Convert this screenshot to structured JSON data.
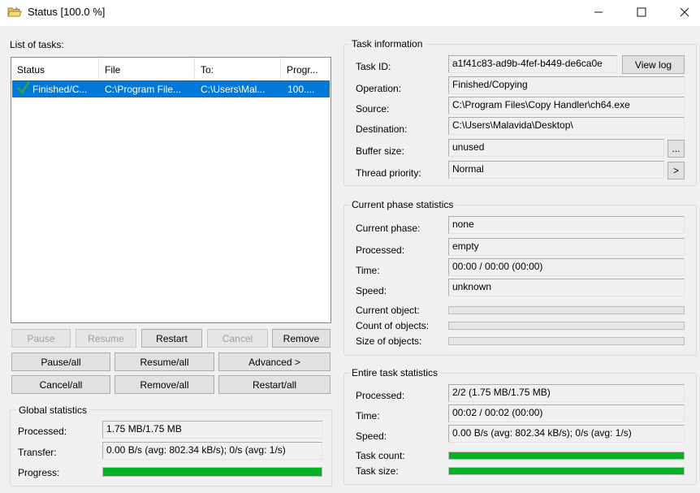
{
  "window": {
    "title": "Status [100.0 %]"
  },
  "tasks": {
    "heading": "List of tasks:",
    "columns": [
      "Status",
      "File",
      "To:",
      "Progr..."
    ],
    "rows": [
      {
        "status": "Finished/C...",
        "file": "C:\\Program File...",
        "to": "C:\\Users\\Mal...",
        "progress": "100...."
      }
    ]
  },
  "task_buttons": {
    "pause": "Pause",
    "resume": "Resume",
    "restart": "Restart",
    "cancel": "Cancel",
    "remove": "Remove",
    "pause_all": "Pause/all",
    "resume_all": "Resume/all",
    "advanced": "Advanced >",
    "cancel_all": "Cancel/all",
    "remove_all": "Remove/all",
    "restart_all": "Restart/all"
  },
  "global_stats": {
    "title": "Global statistics",
    "processed_label": "Processed:",
    "processed": "1.75 MB/1.75 MB",
    "transfer_label": "Transfer:",
    "transfer": "0.00 B/s (avg: 802.34 kB/s); 0/s (avg: 1/s)",
    "progress_label": "Progress:",
    "progress_value": 1.0
  },
  "task_info": {
    "title": "Task information",
    "task_id_label": "Task ID:",
    "task_id": "a1f41c83-ad9b-4fef-b449-de6ca0e",
    "view_log": "View log",
    "operation_label": "Operation:",
    "operation": "Finished/Copying",
    "source_label": "Source:",
    "source": "C:\\Program Files\\Copy Handler\\ch64.exe",
    "destination_label": "Destination:",
    "destination": "C:\\Users\\Malavida\\Desktop\\",
    "buffer_label": "Buffer size:",
    "buffer": "unused",
    "buffer_btn": "...",
    "thread_label": "Thread priority:",
    "thread": "Normal",
    "thread_btn": ">"
  },
  "phase_stats": {
    "title": "Current phase statistics",
    "phase_label": "Current phase:",
    "phase": "none",
    "processed_label": "Processed:",
    "processed": "empty",
    "time_label": "Time:",
    "time": "00:00 / 00:00 (00:00)",
    "speed_label": "Speed:",
    "speed": "unknown",
    "object_label": "Current object:",
    "object_value": 0,
    "count_label": "Count of objects:",
    "count_value": 0,
    "size_label": "Size of objects:",
    "size_value": 0
  },
  "entire_stats": {
    "title": "Entire task statistics",
    "processed_label": "Processed:",
    "processed": "2/2 (1.75 MB/1.75 MB)",
    "time_label": "Time:",
    "time": "00:02 / 00:02 (00:00)",
    "speed_label": "Speed:",
    "speed": "0.00 B/s (avg: 802.34 kB/s); 0/s (avg: 1/s)",
    "count_label": "Task count:",
    "count_value": 1.0,
    "size_label": "Task size:",
    "size_value": 1.0
  },
  "colors": {
    "progress_fill": "#06b025",
    "selection": "#0078d7",
    "check": "#2e9e4f"
  }
}
